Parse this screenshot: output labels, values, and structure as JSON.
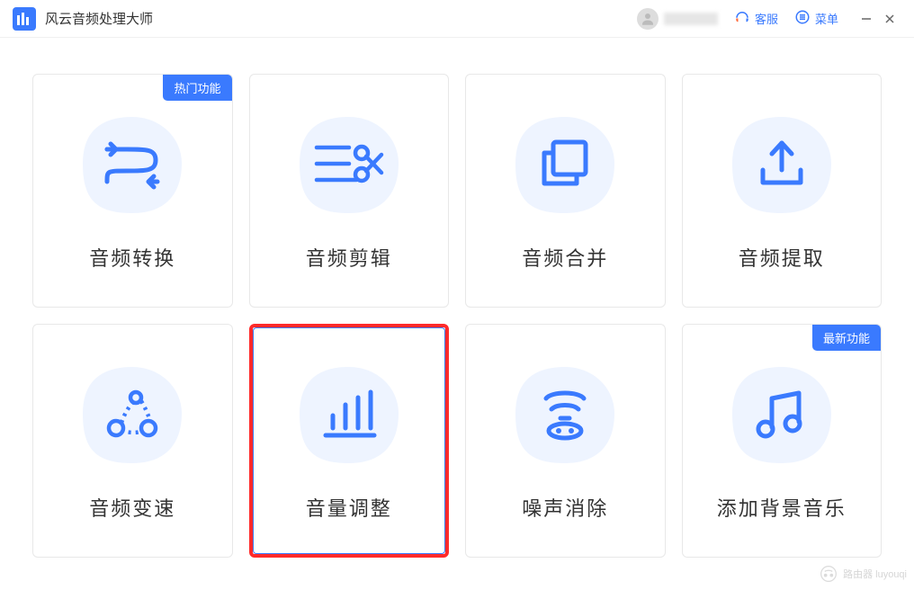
{
  "app": {
    "title": "风云音频处理大师"
  },
  "titlebar": {
    "support_label": "客服",
    "menu_label": "菜单"
  },
  "badges": {
    "hot": "热门功能",
    "new": "最新功能"
  },
  "cards": [
    {
      "label": "音频转换",
      "icon": "convert",
      "badge": "hot"
    },
    {
      "label": "音频剪辑",
      "icon": "cut",
      "badge": null
    },
    {
      "label": "音频合并",
      "icon": "merge",
      "badge": null
    },
    {
      "label": "音频提取",
      "icon": "extract",
      "badge": null
    },
    {
      "label": "音频变速",
      "icon": "speed",
      "badge": null
    },
    {
      "label": "音量调整",
      "icon": "volume",
      "badge": null,
      "highlighted": true
    },
    {
      "label": "噪声消除",
      "icon": "noise",
      "badge": null
    },
    {
      "label": "添加背景音乐",
      "icon": "bgm",
      "badge": "new"
    }
  ],
  "watermark": {
    "text": "路由器 luyouqi"
  }
}
